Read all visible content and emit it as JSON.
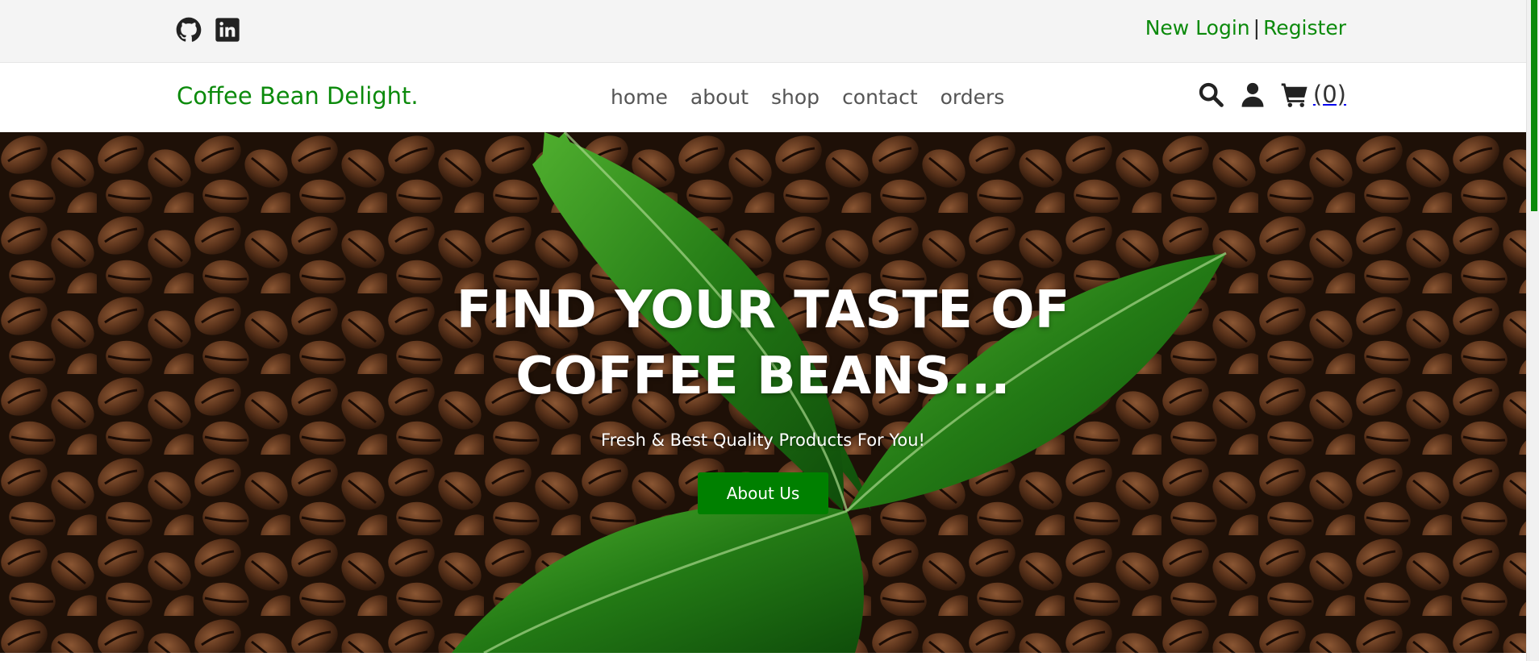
{
  "topbar": {
    "social": [
      {
        "icon": "github-icon"
      },
      {
        "icon": "linkedin-icon"
      }
    ],
    "login_label": "New Login",
    "separator": "|",
    "register_label": "Register"
  },
  "header": {
    "logo": "Coffee Bean Delight.",
    "nav": [
      "home",
      "about",
      "shop",
      "contact",
      "orders"
    ],
    "cart_count": "(0)"
  },
  "hero": {
    "title_line1": "FIND YOUR TASTE OF",
    "title_line2": "COFFEE BEANS...",
    "subtitle": "Fresh & Best Quality Products For You!",
    "button_label": "About Us"
  },
  "colors": {
    "accent": "#0b8a0b",
    "button": "#008000",
    "topbar_bg": "#f4f4f4"
  }
}
